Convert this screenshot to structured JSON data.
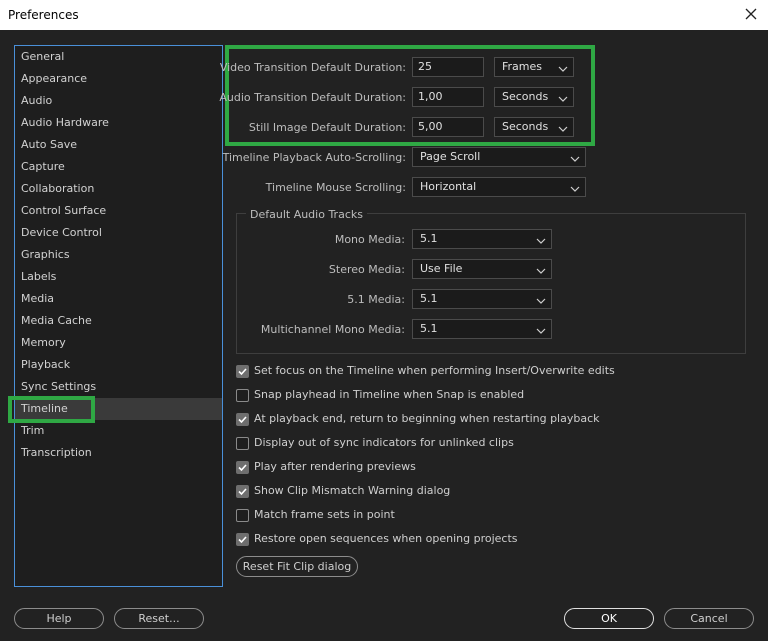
{
  "window": {
    "title": "Preferences"
  },
  "sidebar": {
    "items": [
      {
        "label": "General"
      },
      {
        "label": "Appearance"
      },
      {
        "label": "Audio"
      },
      {
        "label": "Audio Hardware"
      },
      {
        "label": "Auto Save"
      },
      {
        "label": "Capture"
      },
      {
        "label": "Collaboration"
      },
      {
        "label": "Control Surface"
      },
      {
        "label": "Device Control"
      },
      {
        "label": "Graphics"
      },
      {
        "label": "Labels"
      },
      {
        "label": "Media"
      },
      {
        "label": "Media Cache"
      },
      {
        "label": "Memory"
      },
      {
        "label": "Playback"
      },
      {
        "label": "Sync Settings"
      },
      {
        "label": "Timeline"
      },
      {
        "label": "Trim"
      },
      {
        "label": "Transcription"
      }
    ],
    "selected": "Timeline"
  },
  "durations": {
    "video": {
      "label": "Video Transition Default Duration:",
      "value": "25",
      "unit": "Frames"
    },
    "audio": {
      "label": "Audio Transition Default Duration:",
      "value": "1,00",
      "unit": "Seconds"
    },
    "still": {
      "label": "Still Image Default Duration:",
      "value": "5,00",
      "unit": "Seconds"
    }
  },
  "playback_scrolling": {
    "label": "Timeline Playback Auto-Scrolling:",
    "value": "Page Scroll"
  },
  "mouse_scrolling": {
    "label": "Timeline Mouse Scrolling:",
    "value": "Horizontal"
  },
  "audio_tracks": {
    "title": "Default Audio Tracks",
    "mono": {
      "label": "Mono Media:",
      "value": "5.1"
    },
    "stereo": {
      "label": "Stereo Media:",
      "value": "Use File"
    },
    "five_one": {
      "label": "5.1 Media:",
      "value": "5.1"
    },
    "multichannel": {
      "label": "Multichannel Mono Media:",
      "value": "5.1"
    }
  },
  "checkboxes": [
    {
      "label": "Set focus on the Timeline when performing Insert/Overwrite edits",
      "checked": true
    },
    {
      "label": "Snap playhead in Timeline when Snap is enabled",
      "checked": false
    },
    {
      "label": "At playback end, return to beginning when restarting playback",
      "checked": true
    },
    {
      "label": "Display out of sync indicators for unlinked clips",
      "checked": false
    },
    {
      "label": "Play after rendering previews",
      "checked": true
    },
    {
      "label": "Show Clip Mismatch Warning dialog",
      "checked": true
    },
    {
      "label": "Match frame sets in point",
      "checked": false
    },
    {
      "label": "Restore open sequences when opening projects",
      "checked": true
    }
  ],
  "buttons": {
    "reset_fit": "Reset Fit Clip dialog",
    "help": "Help",
    "reset": "Reset...",
    "ok": "OK",
    "cancel": "Cancel"
  },
  "colors": {
    "highlight": "#2fa844",
    "sidebar_border": "#4a90d9",
    "background": "#222222"
  },
  "icons": {
    "close": "close-icon",
    "dropdown": "chevron-down-icon",
    "check": "checkmark-icon"
  }
}
